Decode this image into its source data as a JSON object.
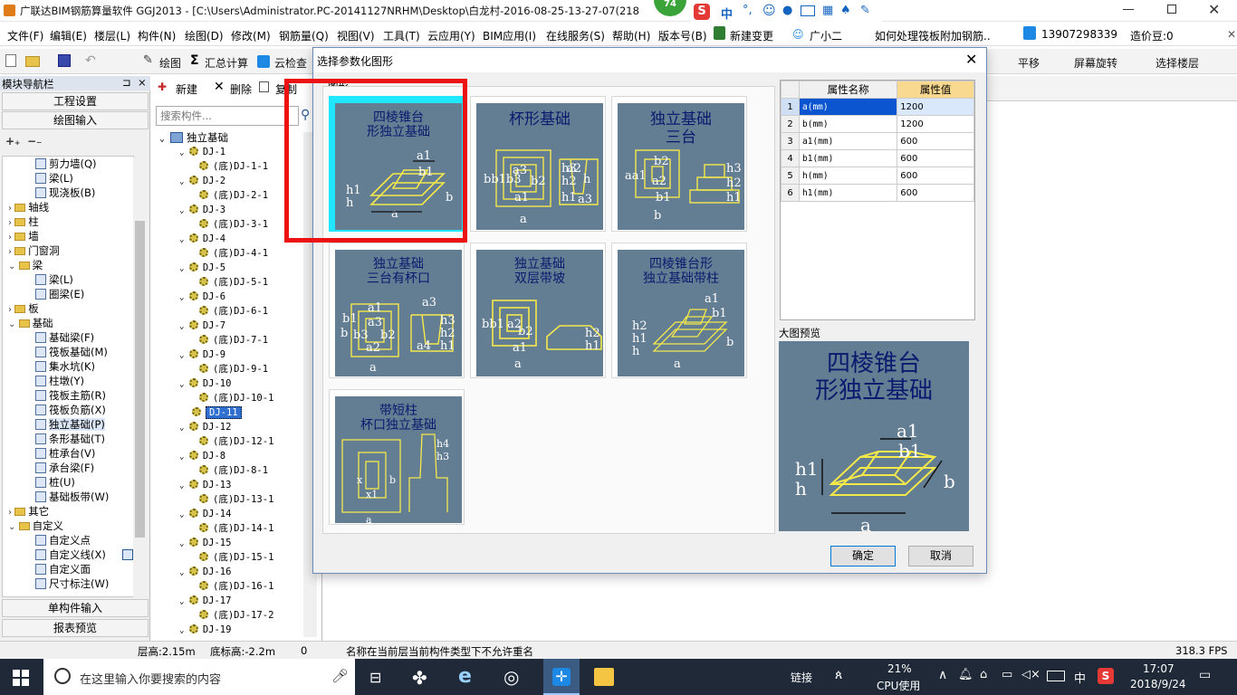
{
  "app": {
    "title": "广联达BIM钢筋算量软件 GGJ2013 - [C:\\Users\\Administrator.PC-20141127NRHM\\Desktop\\白龙村-2016-08-25-13-27-07(218",
    "badge": "74",
    "ime_label": "中"
  },
  "menu": [
    "文件(F)",
    "编辑(E)",
    "楼层(L)",
    "构件(N)",
    "绘图(D)",
    "修改(M)",
    "钢筋量(Q)",
    "视图(V)",
    "工具(T)",
    "云应用(Y)",
    "BIM应用(I)",
    "在线服务(S)",
    "帮助(H)",
    "版本号(B)"
  ],
  "menu_right": {
    "new_change": "新建变更",
    "assistant": "广小二",
    "question": "如何处理筏板附加钢筋..",
    "phone": "13907298339",
    "price": "造价豆:0"
  },
  "toolbar": {
    "draw": "绘图",
    "sum": "汇总计算",
    "cloud_check": "云检查",
    "pan": "平移",
    "rotate": "屏幕旋转",
    "select_floor": "选择楼层"
  },
  "nav": {
    "header": "模块导航栏",
    "project_settings": "工程设置",
    "drawing_input": "绘图输入",
    "items": [
      {
        "label": "剪力墙(Q)",
        "type": "sub"
      },
      {
        "label": "梁(L)",
        "type": "sub"
      },
      {
        "label": "现浇板(B)",
        "type": "sub"
      },
      {
        "label": "轴线",
        "type": "folder"
      },
      {
        "label": "柱",
        "type": "folder"
      },
      {
        "label": "墙",
        "type": "folder"
      },
      {
        "label": "门窗洞",
        "type": "folder"
      },
      {
        "label": "梁",
        "type": "folder"
      },
      {
        "label": "梁(L)",
        "type": "sub"
      },
      {
        "label": "圈梁(E)",
        "type": "sub"
      },
      {
        "label": "板",
        "type": "folder"
      },
      {
        "label": "基础",
        "type": "folder"
      },
      {
        "label": "基础梁(F)",
        "type": "sub"
      },
      {
        "label": "筏板基础(M)",
        "type": "sub"
      },
      {
        "label": "集水坑(K)",
        "type": "sub"
      },
      {
        "label": "柱墩(Y)",
        "type": "sub"
      },
      {
        "label": "筏板主筋(R)",
        "type": "sub"
      },
      {
        "label": "筏板负筋(X)",
        "type": "sub"
      },
      {
        "label": "独立基础(P)",
        "type": "sub"
      },
      {
        "label": "条形基础(T)",
        "type": "sub"
      },
      {
        "label": "桩承台(V)",
        "type": "sub"
      },
      {
        "label": "承台梁(F)",
        "type": "sub"
      },
      {
        "label": "桩(U)",
        "type": "sub"
      },
      {
        "label": "基础板带(W)",
        "type": "sub"
      },
      {
        "label": "其它",
        "type": "folder"
      },
      {
        "label": "自定义",
        "type": "folder"
      },
      {
        "label": "自定义点",
        "type": "sub"
      },
      {
        "label": "自定义线(X)",
        "type": "sub"
      },
      {
        "label": "自定义面",
        "type": "sub"
      },
      {
        "label": "尺寸标注(W)",
        "type": "sub"
      }
    ],
    "single_input": "单构件输入",
    "report_preview": "报表预览"
  },
  "components": {
    "new_label": "新建",
    "delete_label": "删除",
    "copy_label": "复制",
    "search_placeholder": "搜索构件...",
    "root": "独立基础",
    "items": [
      {
        "label": "DJ-1",
        "level": 1
      },
      {
        "label": "(底)DJ-1-1",
        "level": 2
      },
      {
        "label": "DJ-2",
        "level": 1
      },
      {
        "label": "(底)DJ-2-1",
        "level": 2
      },
      {
        "label": "DJ-3",
        "level": 1
      },
      {
        "label": "(底)DJ-3-1",
        "level": 2
      },
      {
        "label": "DJ-4",
        "level": 1
      },
      {
        "label": "(底)DJ-4-1",
        "level": 2
      },
      {
        "label": "DJ-5",
        "level": 1
      },
      {
        "label": "(底)DJ-5-1",
        "level": 2
      },
      {
        "label": "DJ-6",
        "level": 1
      },
      {
        "label": "(底)DJ-6-1",
        "level": 2
      },
      {
        "label": "DJ-7",
        "level": 1
      },
      {
        "label": "(底)DJ-7-1",
        "level": 2
      },
      {
        "label": "DJ-9",
        "level": 1
      },
      {
        "label": "(底)DJ-9-1",
        "level": 2
      },
      {
        "label": "DJ-10",
        "level": 1
      },
      {
        "label": "(底)DJ-10-1",
        "level": 2
      },
      {
        "label": "DJ-11",
        "level": 1,
        "selected": true
      },
      {
        "label": "DJ-12",
        "level": 1
      },
      {
        "label": "(底)DJ-12-1",
        "level": 2
      },
      {
        "label": "DJ-8",
        "level": 1
      },
      {
        "label": "(底)DJ-8-1",
        "level": 2
      },
      {
        "label": "DJ-13",
        "level": 1
      },
      {
        "label": "(底)DJ-13-1",
        "level": 2
      },
      {
        "label": "DJ-14",
        "level": 1
      },
      {
        "label": "(底)DJ-14-1",
        "level": 2
      },
      {
        "label": "DJ-15",
        "level": 1
      },
      {
        "label": "(底)DJ-15-1",
        "level": 2
      },
      {
        "label": "DJ-16",
        "level": 1
      },
      {
        "label": "(底)DJ-16-1",
        "level": 2
      },
      {
        "label": "DJ-17",
        "level": 1
      },
      {
        "label": "(底)DJ-17-2",
        "level": 2
      },
      {
        "label": "DJ-19",
        "level": 1
      }
    ]
  },
  "dialog": {
    "title": "选择参数化图形",
    "group_label": "图形",
    "tiles": [
      {
        "label": "四棱锥台\n形独立基础",
        "selected": true
      },
      {
        "label": "杯形基础"
      },
      {
        "label": "独立基础\n三台"
      },
      {
        "label": "独立基础\n三台有杯口"
      },
      {
        "label": "独立基础\n双层带坡"
      },
      {
        "label": "四棱锥台形\n独立基础带柱"
      },
      {
        "label": "带短柱\n杯口独立基础"
      }
    ],
    "table": {
      "headers": [
        "属性名称",
        "属性值"
      ],
      "rows": [
        {
          "num": "1",
          "name": "a(mm)",
          "value": "1200"
        },
        {
          "num": "2",
          "name": "b(mm)",
          "value": "1200"
        },
        {
          "num": "3",
          "name": "a1(mm)",
          "value": "600"
        },
        {
          "num": "4",
          "name": "b1(mm)",
          "value": "600"
        },
        {
          "num": "5",
          "name": "h(mm)",
          "value": "600"
        },
        {
          "num": "6",
          "name": "h1(mm)",
          "value": "600"
        }
      ]
    },
    "preview_label": "大图预览",
    "preview_title": "四棱锥台\n形独立基础",
    "ok": "确定",
    "cancel": "取消"
  },
  "status": {
    "floor_height": "层高:2.15m",
    "bottom_height": "底标高:-2.2m",
    "zero": "0",
    "message": "名称在当前层当前构件类型下不允许重名",
    "fps": "318.3 FPS"
  },
  "taskbar": {
    "search_placeholder": "在这里输入你要搜索的内容",
    "link": "链接",
    "cpu_percent": "21%",
    "cpu_label": "CPU使用",
    "ime": "中",
    "time": "17:07",
    "date": "2018/9/24"
  }
}
